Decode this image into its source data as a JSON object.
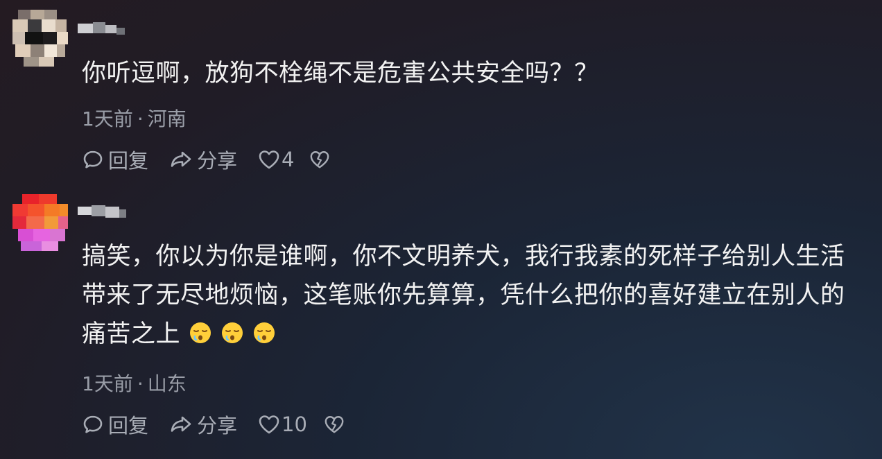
{
  "comments": [
    {
      "text": "你听逗啊，放狗不栓绳不是危害公共安全吗？？",
      "time": "1天前",
      "location": "河南",
      "reply_label": "回复",
      "share_label": "分享",
      "likes": "4",
      "icons": [
        "comment-bubble-icon",
        "share-arrow-icon",
        "heart-icon",
        "broken-heart-icon"
      ]
    },
    {
      "text": "搞笑，你以为你是谁啊，你不文明养犬，我行我素的死样子给别人生活带来了无尽地烦恼，这笔账你先算算，凭什么把你的喜好建立在别人的痛苦之上",
      "emojis": [
        "sleepy-face-emoji",
        "sleepy-face-emoji",
        "sleepy-face-emoji"
      ],
      "time": "1天前",
      "location": "山东",
      "reply_label": "回复",
      "share_label": "分享",
      "likes": "10",
      "icons": [
        "comment-bubble-icon",
        "share-arrow-icon",
        "heart-icon",
        "broken-heart-icon"
      ]
    }
  ],
  "colors": {
    "text_primary": "#f2f2f2",
    "text_secondary": "#9a9ea8",
    "action_gray": "#a9adb6"
  }
}
